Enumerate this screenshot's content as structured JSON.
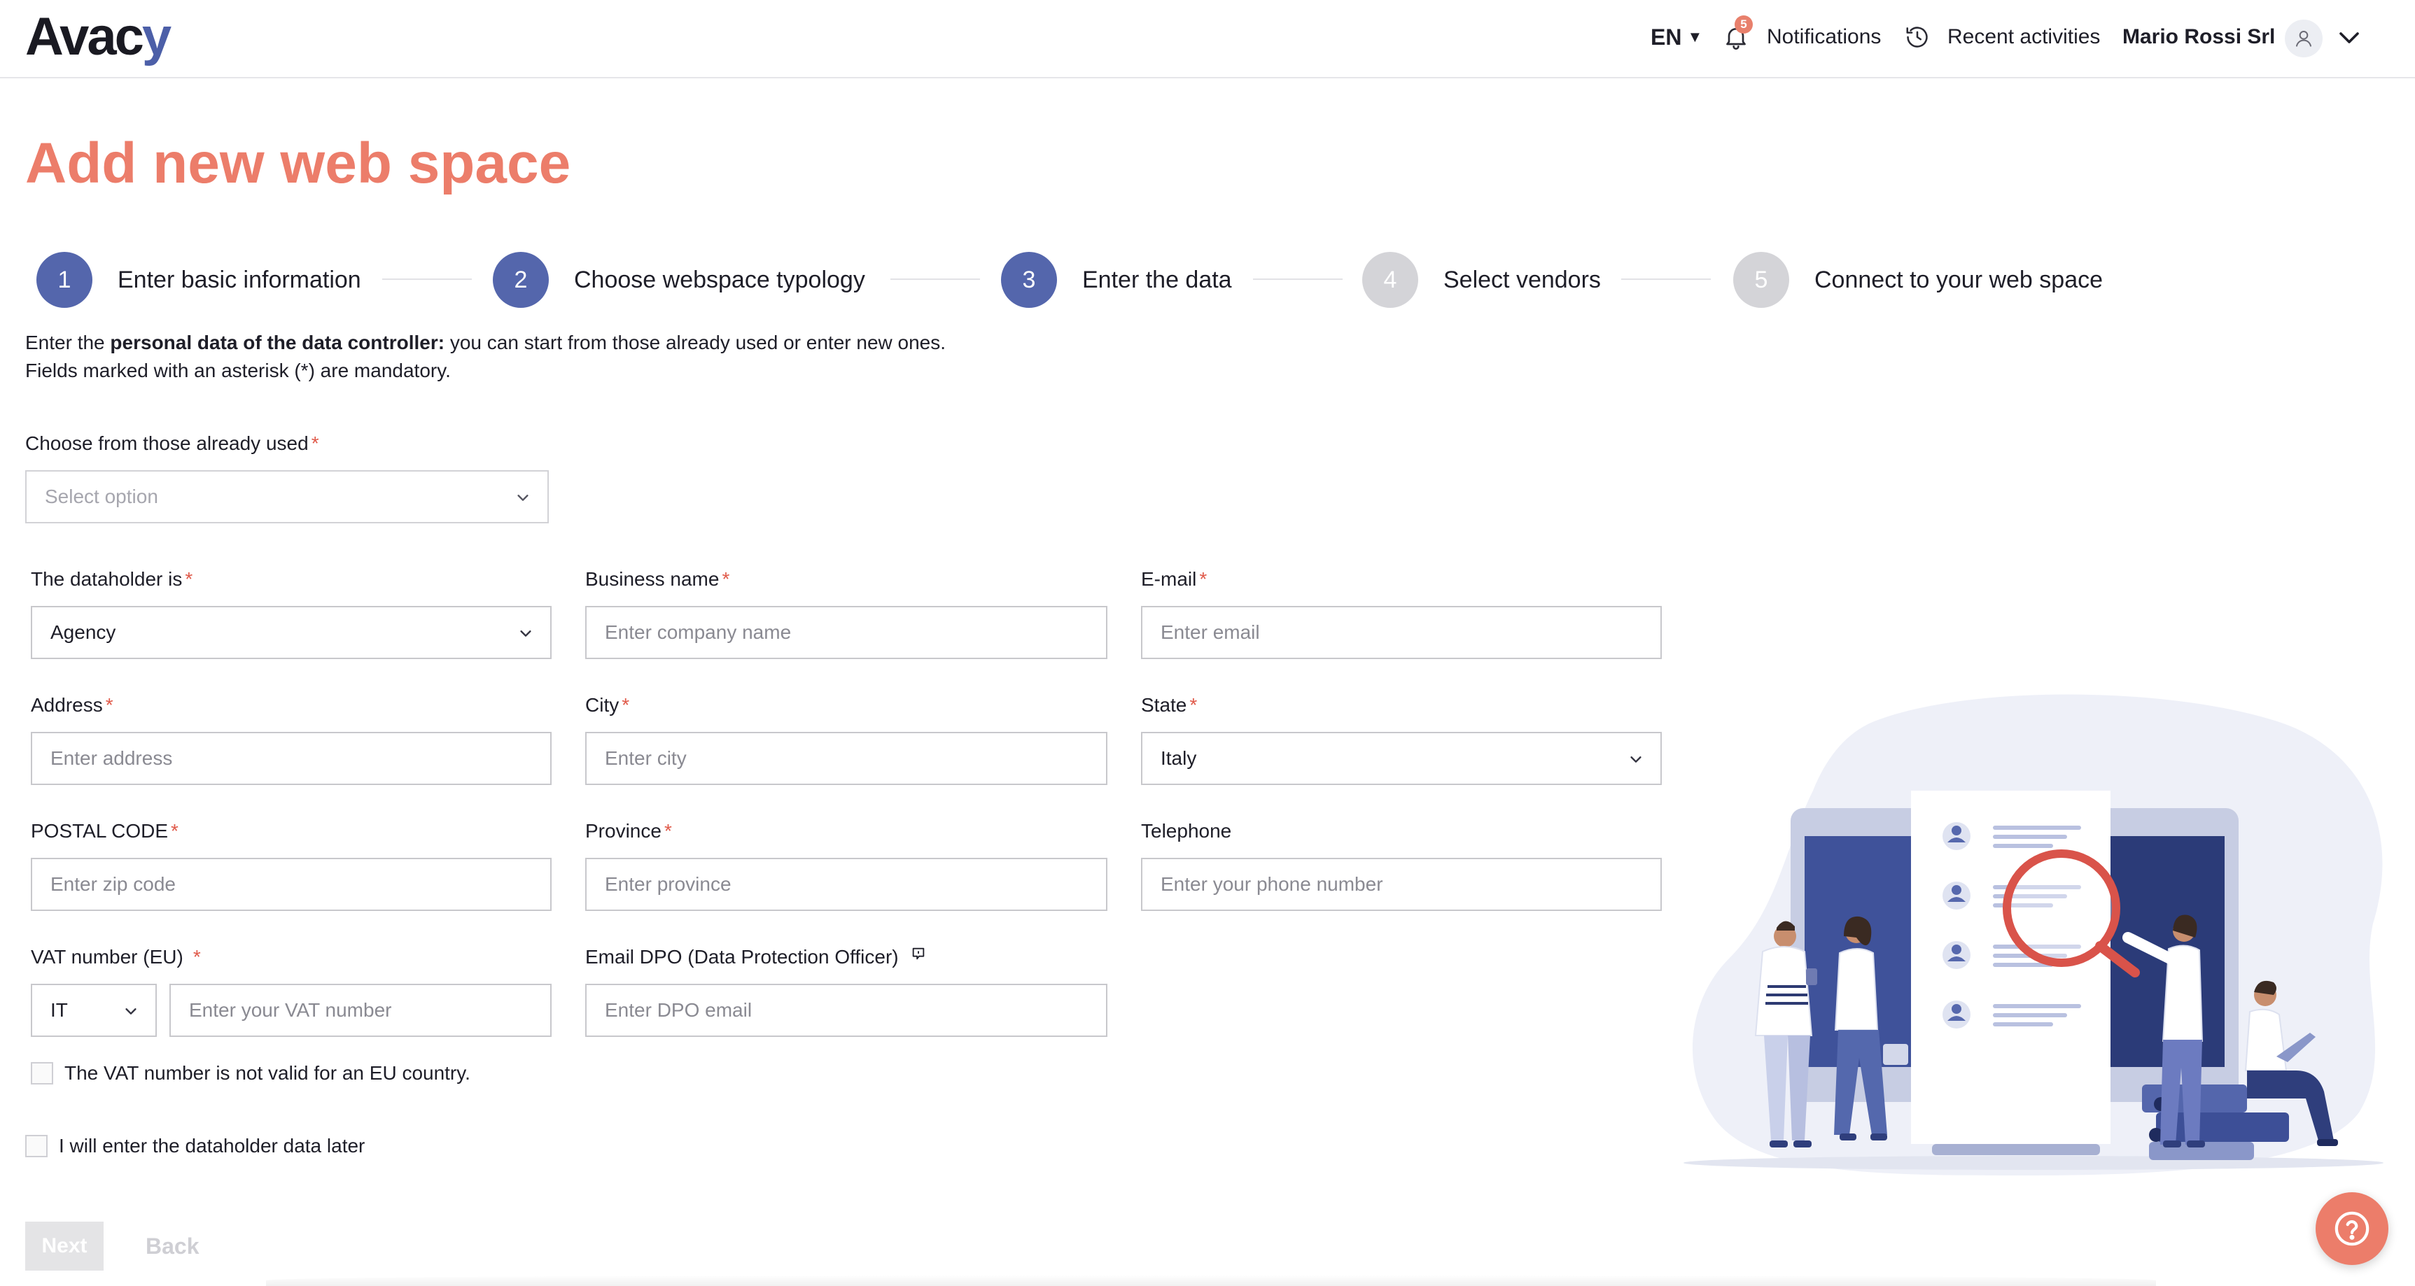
{
  "header": {
    "logo_prefix": "Av",
    "logo_mid": "ac",
    "logo_suffix": "y",
    "language": "EN",
    "notification_count": "5",
    "notifications_label": "Notifications",
    "recent_label": "Recent activities",
    "company": "Mario Rossi Srl",
    "icons": [
      "bell-icon",
      "history-icon",
      "user-icon",
      "chevron-down-icon"
    ]
  },
  "page": {
    "title": "Add new web space"
  },
  "stepper": {
    "steps": [
      {
        "number": "1",
        "label": "Enter basic information",
        "state": "done"
      },
      {
        "number": "2",
        "label": "Choose webspace typology",
        "state": "done"
      },
      {
        "number": "3",
        "label": "Enter the data",
        "state": "current"
      },
      {
        "number": "4",
        "label": "Select vendors",
        "state": "todo"
      },
      {
        "number": "5",
        "label": "Connect to your web space",
        "state": "todo"
      }
    ],
    "active_color": "#5466ac",
    "inactive_color": "#d4d4d8"
  },
  "intro": {
    "line1_prefix": "Enter the",
    "line1_bold": "personal data of the data controller:",
    "line1_suffix": "you can start from those already used or enter new ones.",
    "line2": "Fields marked with an asterisk (*) are mandatory."
  },
  "form": {
    "existing": {
      "label": "Choose from those already used",
      "required": "*",
      "placeholder": "Select option"
    },
    "dataholder": {
      "label": "The dataholder is",
      "required": "*",
      "value": "Agency"
    },
    "business_name": {
      "label": "Business name",
      "required": "*",
      "placeholder": "Enter company name"
    },
    "email": {
      "label": "E-mail",
      "required": "*",
      "placeholder": "Enter email"
    },
    "address": {
      "label": "Address",
      "required": "*",
      "placeholder": "Enter address"
    },
    "city": {
      "label": "City",
      "required": "*",
      "placeholder": "Enter city"
    },
    "state": {
      "label": "State",
      "required": "*",
      "value": "Italy"
    },
    "postal_code": {
      "label": "POSTAL CODE",
      "required": "*",
      "placeholder": "Enter zip code"
    },
    "province": {
      "label": "Province",
      "required": "*",
      "placeholder": "Enter province"
    },
    "telephone": {
      "label": "Telephone",
      "placeholder": "Enter your phone number"
    },
    "vat": {
      "label": "VAT number (EU)",
      "required": "*",
      "country": "IT",
      "placeholder": "Enter your VAT number"
    },
    "dpo_email": {
      "label": "Email DPO (Data Protection Officer)",
      "placeholder": "Enter DPO email"
    },
    "vat_not_eu_label": "The VAT number is not valid for an EU country.",
    "enter_later_label": "I will enter the dataholder data later"
  },
  "actions": {
    "next_label": "Next",
    "back_label": "Back"
  },
  "theme": {
    "accent": "#ec7d6a",
    "primary": "#5466ac",
    "required": "#e05a4a"
  }
}
